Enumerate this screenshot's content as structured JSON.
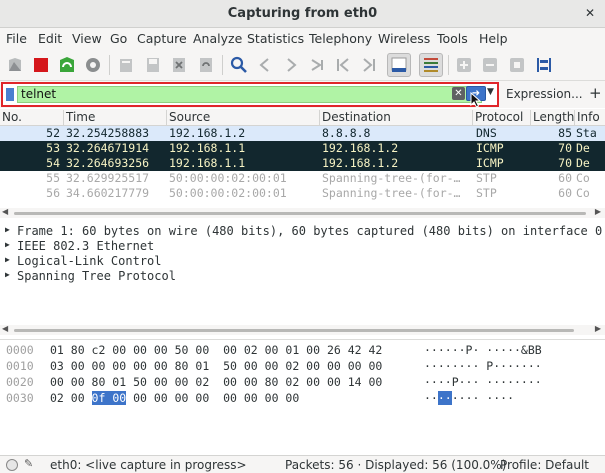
{
  "window": {
    "title": "Capturing from eth0"
  },
  "menu": [
    "File",
    "Edit",
    "View",
    "Go",
    "Capture",
    "Analyze",
    "Statistics",
    "Telephony",
    "Wireless",
    "Tools",
    "Help"
  ],
  "filter": {
    "value": "telnet",
    "expression_label": "Expression...",
    "plus_label": "+"
  },
  "packet_list": {
    "columns": [
      "No.",
      "Time",
      "Source",
      "Destination",
      "Protocol",
      "Length",
      "Info"
    ],
    "rows": [
      {
        "no": "52",
        "time": "32.254258883",
        "source": "192.168.1.2",
        "destination": "8.8.8.8",
        "protocol": "DNS",
        "length": "85",
        "info": "Sta",
        "style": "dns"
      },
      {
        "no": "53",
        "time": "32.264671914",
        "source": "192.168.1.1",
        "destination": "192.168.1.2",
        "protocol": "ICMP",
        "length": "70",
        "info": "De",
        "style": "icmp"
      },
      {
        "no": "54",
        "time": "32.264693256",
        "source": "192.168.1.1",
        "destination": "192.168.1.2",
        "protocol": "ICMP",
        "length": "70",
        "info": "De",
        "style": "icmp"
      },
      {
        "no": "55",
        "time": "32.629925517",
        "source": "50:00:00:02:00:01",
        "destination": "Spanning-tree-(for-…",
        "protocol": "STP",
        "length": "60",
        "info": "Co",
        "style": "stp"
      },
      {
        "no": "56",
        "time": "34.660217779",
        "source": "50:00:00:02:00:01",
        "destination": "Spanning-tree-(for-…",
        "protocol": "STP",
        "length": "60",
        "info": "Co",
        "style": "stp"
      }
    ]
  },
  "details": [
    "Frame 1: 60 bytes on wire (480 bits), 60 bytes captured (480 bits) on interface 0",
    "IEEE 802.3 Ethernet",
    "Logical-Link Control",
    "Spanning Tree Protocol"
  ],
  "bytes": [
    {
      "offset": "0000",
      "hex": "01 80 c2 00 00 00 50 00  00 02 00 01 00 26 42 42",
      "ascii": "······P· ·····&BB"
    },
    {
      "offset": "0010",
      "hex": "03 00 00 00 00 00 80 01  50 00 00 02 00 00 00 00",
      "ascii": "········ P·······"
    },
    {
      "offset": "0020",
      "hex": "00 00 80 01 50 00 00 02  00 00 80 02 00 00 14 00",
      "ascii": "····P··· ········"
    },
    {
      "offset": "0030",
      "hex_pre": "02 00 ",
      "hex_hl": "0f 00",
      "hex_post": " 00 00 00 00  00 00 00 00",
      "ascii_pre": "··",
      "ascii_hl": "··",
      "ascii_post": "···· ····"
    }
  ],
  "status": {
    "capture": "eth0: <live capture in progress>",
    "packets": "Packets: 56 · Displayed: 56 (100.0%)",
    "profile": "Profile: Default"
  },
  "colors": {
    "filter_valid": "#b0f3a5",
    "highlight_border": "#e0262a",
    "dns_row": "#dbe9fa",
    "icmp_row": "#12272e",
    "icmp_text": "#f7f3c4",
    "selection": "#3d74c9"
  }
}
